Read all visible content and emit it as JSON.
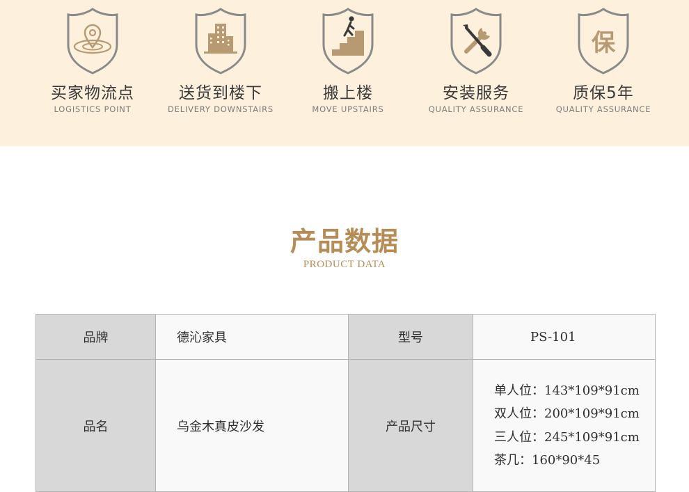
{
  "services": [
    {
      "icon": "location-pin-icon",
      "title": "买家物流点",
      "subtitle": "LOGISTICS POINT"
    },
    {
      "icon": "building-icon",
      "title": "送货到楼下",
      "subtitle": "DELIVERY DOWNSTAIRS"
    },
    {
      "icon": "stairs-climber-icon",
      "title": "搬上楼",
      "subtitle": "MOVE UPSTAIRS"
    },
    {
      "icon": "wrench-screwdriver-icon",
      "title": "安装服务",
      "subtitle": "QUALITY ASSURANCE"
    },
    {
      "icon": "warranty-char-icon",
      "title": "质保5年",
      "subtitle": "QUALITY ASSURANCE",
      "glyph": "保"
    }
  ],
  "section": {
    "title": "产品数据",
    "subtitle": "PRODUCT DATA"
  },
  "spec": {
    "brand_label": "品牌",
    "brand_value": "德沁家具",
    "model_label": "型号",
    "model_value": "PS-101",
    "name_label": "品名",
    "name_value": "乌金木真皮沙发",
    "size_label": "产品尺寸",
    "sizes": [
      "单人位：143*109*91cm",
      "双人位：200*109*91cm",
      "三人位：245*109*91cm",
      "茶几：160*90*45"
    ]
  },
  "colors": {
    "band": "#fdf0dc",
    "accent": "#b68d56",
    "shield": "#8a8a8a",
    "icon": "#b79a72",
    "label_cell": "#d8d8d8"
  }
}
